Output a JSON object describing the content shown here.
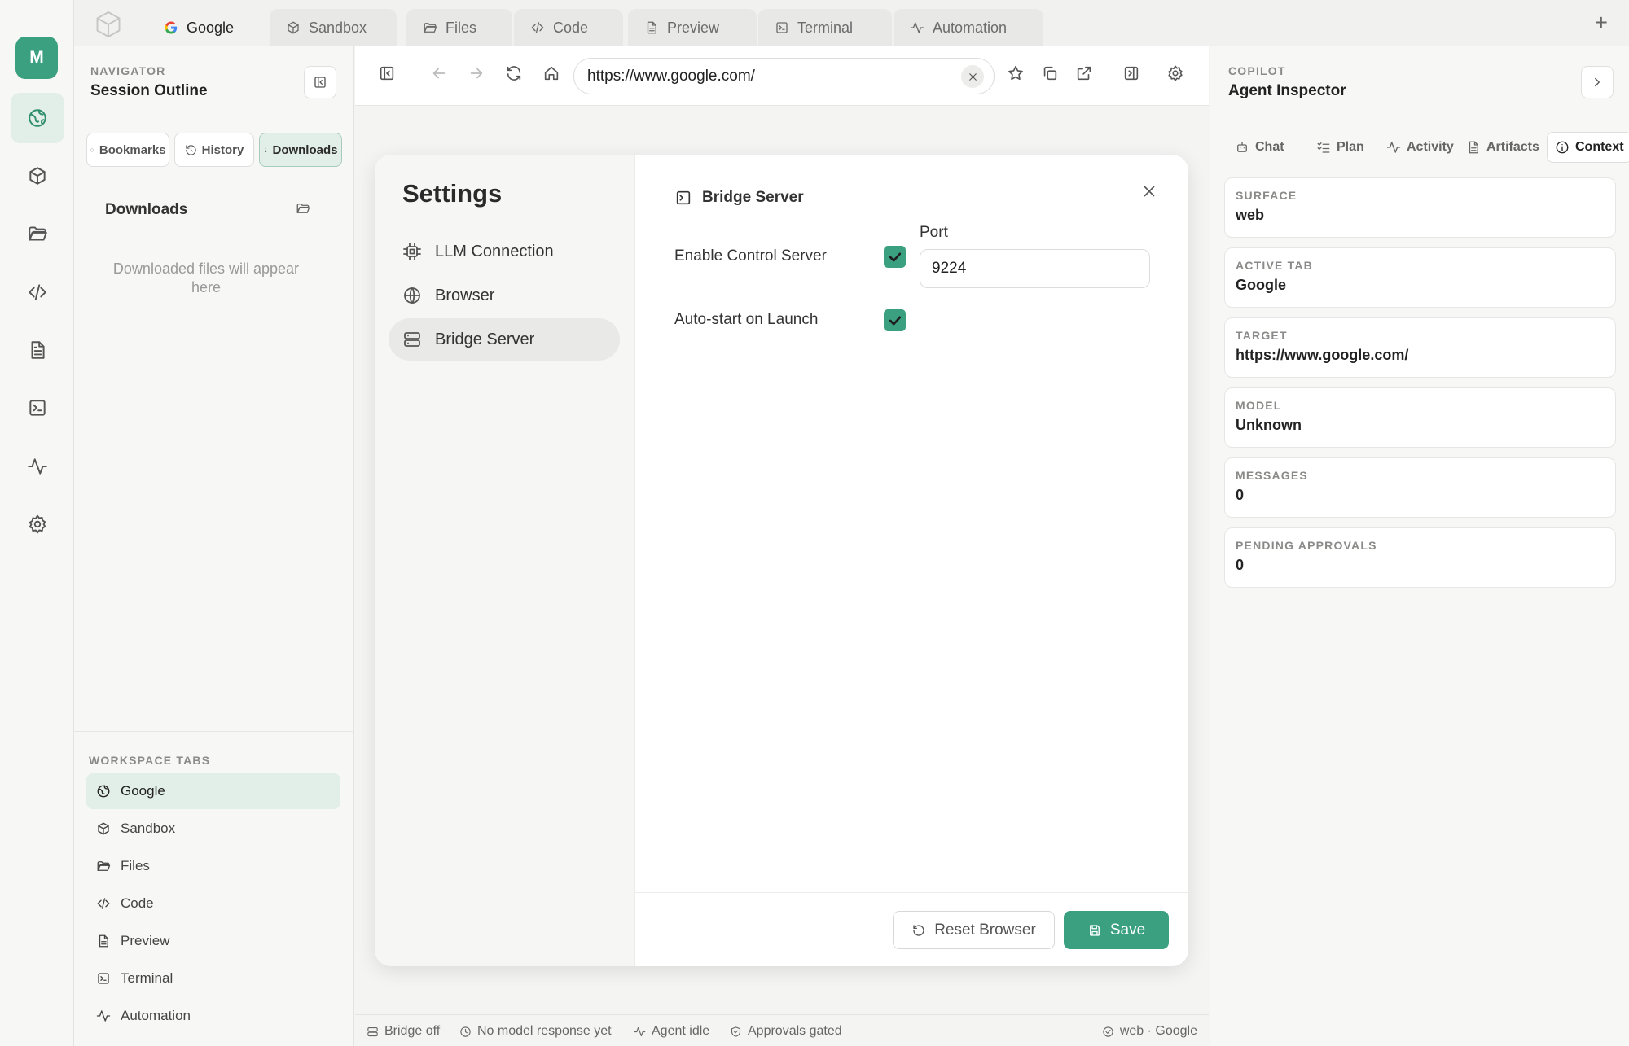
{
  "rail": {
    "avatar": "M",
    "items": [
      "web-icon",
      "sandbox-icon",
      "files-icon",
      "code-icon",
      "preview-icon",
      "terminal-icon",
      "automation-icon",
      "settings-icon"
    ]
  },
  "tabs": [
    {
      "label": "Google",
      "icon": "google-icon",
      "active": true
    },
    {
      "label": "Sandbox",
      "icon": "cube-icon"
    },
    {
      "label": "Files",
      "icon": "folder-icon"
    },
    {
      "label": "Code",
      "icon": "code-icon"
    },
    {
      "label": "Preview",
      "icon": "file-icon"
    },
    {
      "label": "Terminal",
      "icon": "terminal-icon"
    },
    {
      "label": "Automation",
      "icon": "activity-icon"
    }
  ],
  "new_tab": "+",
  "navigator": {
    "eyebrow": "NAVIGATOR",
    "title": "Session Outline",
    "segments": [
      "Bookmarks",
      "History",
      "Downloads"
    ],
    "active_segment": "Downloads",
    "downloads_title": "Downloads",
    "downloads_empty": "Downloaded files will appear here",
    "workspace_label": "WORKSPACE TABS",
    "workspace_tabs": [
      "Google",
      "Sandbox",
      "Files",
      "Code",
      "Preview",
      "Terminal",
      "Automation"
    ]
  },
  "toolbar": {
    "url": "https://www.google.com/"
  },
  "settings": {
    "title": "Settings",
    "sections": [
      "LLM Connection",
      "Browser",
      "Bridge Server"
    ],
    "active_section": "Bridge Server",
    "pane_title": "Bridge Server",
    "enable_control_server_label": "Enable Control Server",
    "enable_control_server": true,
    "port_label": "Port",
    "port_value": "9224",
    "auto_start_label": "Auto-start on Launch",
    "auto_start": true,
    "reset_label": "Reset Browser",
    "save_label": "Save"
  },
  "status": {
    "bridge": "Bridge off",
    "model": "No model response yet",
    "agent": "Agent idle",
    "approvals": "Approvals gated",
    "context": "web · Google"
  },
  "copilot": {
    "eyebrow": "COPILOT",
    "title": "Agent Inspector",
    "tabs": [
      "Chat",
      "Plan",
      "Activity",
      "Artifacts",
      "Context"
    ],
    "active_tab": "Context",
    "cards": [
      {
        "key": "SURFACE",
        "value": "web"
      },
      {
        "key": "ACTIVE TAB",
        "value": "Google"
      },
      {
        "key": "TARGET",
        "value": "https://www.google.com/"
      },
      {
        "key": "MODEL",
        "value": "Unknown"
      },
      {
        "key": "MESSAGES",
        "value": "0"
      },
      {
        "key": "PENDING APPROVALS",
        "value": "0"
      }
    ]
  },
  "colors": {
    "accent": "#3aa07f",
    "accent_soft": "#e2eee8"
  }
}
